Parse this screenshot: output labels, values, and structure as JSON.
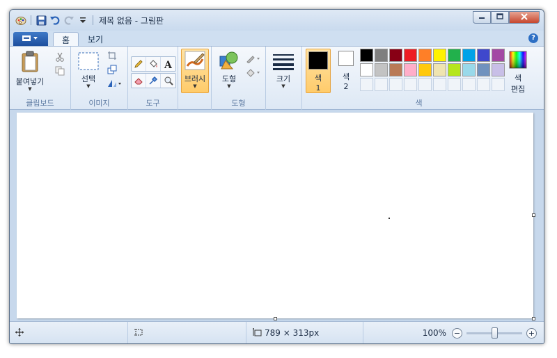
{
  "titlebar": {
    "title": "제목 없음 - 그림판",
    "icons": [
      "paint-app-icon",
      "save-icon",
      "undo-icon",
      "redo-icon",
      "customize-qat-icon"
    ],
    "controls": [
      "minimize-icon",
      "maximize-icon",
      "close-icon"
    ]
  },
  "tabs": {
    "file_label": "",
    "home": "홈",
    "view": "보기",
    "help_symbol": "?"
  },
  "ribbon": {
    "clipboard": {
      "group_label": "클립보드",
      "paste_label": "붙여넣기"
    },
    "image": {
      "group_label": "이미지",
      "select_label": "선택"
    },
    "tools": {
      "group_label": "도구"
    },
    "brushes": {
      "label": "브러시"
    },
    "shapes": {
      "group_label": "도형",
      "shapes_label": "도형"
    },
    "size": {
      "label": "크기"
    },
    "colors": {
      "group_label": "색",
      "color1_line1": "색",
      "color1_line2": "1",
      "color2_line1": "색",
      "color2_line2": "2",
      "edit_line1": "색",
      "edit_line2": "편집",
      "color1_value": "#000000",
      "color2_value": "#ffffff",
      "palette_row1": [
        "#000000",
        "#7f7f7f",
        "#880015",
        "#ed1c24",
        "#ff7f27",
        "#fff200",
        "#22b14c",
        "#00a2e8",
        "#3f48cc",
        "#a349a4"
      ],
      "palette_row2": [
        "#ffffff",
        "#c3c3c3",
        "#b97a57",
        "#ffaec9",
        "#ffc90e",
        "#efe4b0",
        "#b5e61d",
        "#99d9ea",
        "#7092be",
        "#c8bfe7"
      ],
      "custom_slots": 10
    }
  },
  "status": {
    "canvas_size": "789 × 313px",
    "zoom": "100%",
    "zoom_level": 0.5
  }
}
